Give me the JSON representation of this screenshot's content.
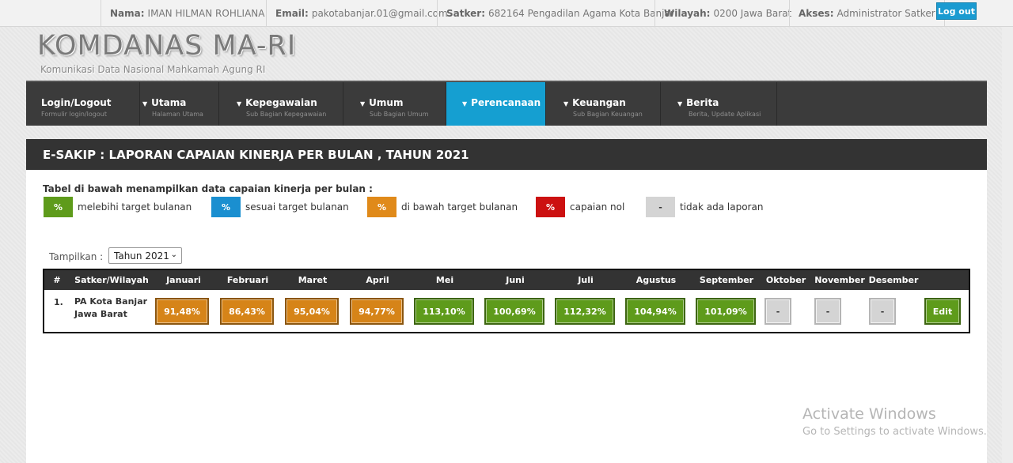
{
  "topbar": {
    "nama_label": "Nama:",
    "nama_value": "IMAN HILMAN ROHLIANA",
    "email_label": "Email:",
    "email_value": "pakotabanjar.01@gmail.com",
    "satker_label": "Satker:",
    "satker_value": "682164 Pengadilan Agama Kota Banjar",
    "wilayah_label": "Wilayah:",
    "wilayah_value": "0200 Jawa Barat",
    "akses_label": "Akses:",
    "akses_value": "Administrator Satker",
    "logout_label": "Log out"
  },
  "logo": {
    "title": "KOMDANAS MA-RI",
    "subtitle": "Komunikasi Data Nasional Mahkamah Agung RI"
  },
  "nav": [
    {
      "label": "Login/Logout",
      "sub": "Formulir login/logout",
      "caret": false
    },
    {
      "label": "Utama",
      "sub": "Halaman Utama",
      "caret": true
    },
    {
      "label": "Kepegawaian",
      "sub": "Sub Bagian Kepegawaian",
      "caret": true
    },
    {
      "label": "Umum",
      "sub": "Sub Bagian Umum",
      "caret": true
    },
    {
      "label": "Perencanaan",
      "sub": "",
      "caret": true,
      "active": true
    },
    {
      "label": "Keuangan",
      "sub": "Sub Bagian Keuangan",
      "caret": true
    },
    {
      "label": "Berita",
      "sub": "Berita, Update Aplikasi",
      "caret": true
    }
  ],
  "panel": {
    "title": "E-SAKIP : LAPORAN CAPAIAN KINERJA PER BULAN , TAHUN 2021",
    "legend_title": "Tabel di bawah menampilkan data capaian kinerja per bulan :",
    "legend": [
      {
        "symbol": "%",
        "text": "melebihi target bulanan",
        "color": "#5e9b1b"
      },
      {
        "symbol": "%",
        "text": "sesuai target bulanan",
        "color": "#1a8fd0"
      },
      {
        "symbol": "%",
        "text": "di bawah target bulanan",
        "color": "#e08a1a"
      },
      {
        "symbol": "%",
        "text": "capaian nol",
        "color": "#cc1111"
      },
      {
        "symbol": "-",
        "text": "tidak ada laporan",
        "color": "#d4d4d4"
      }
    ],
    "tampilkan_label": "Tampilkan :",
    "year_selected": "Tahun 2021"
  },
  "table": {
    "headers": [
      "#",
      "Satker/Wilayah",
      "Januari",
      "Februari",
      "Maret",
      "April",
      "Mei",
      "Juni",
      "Juli",
      "Agustus",
      "September",
      "Oktober",
      "November",
      "Desember"
    ],
    "rows": [
      {
        "num": "1.",
        "satker_line1": "PA Kota Banjar",
        "satker_line2": "Jawa Barat",
        "values": [
          "91,48%",
          "86,43%",
          "95,04%",
          "94,77%",
          "113,10%",
          "100,69%",
          "112,32%",
          "104,94%",
          "101,09%",
          "-",
          "-",
          "-"
        ],
        "status": [
          "orange",
          "orange",
          "orange",
          "orange",
          "green",
          "green",
          "green",
          "green",
          "green",
          "grey",
          "grey",
          "grey"
        ],
        "edit_label": "Edit"
      }
    ]
  },
  "watermark": {
    "line1": "Activate Windows",
    "line2": "Go to Settings to activate Windows."
  }
}
